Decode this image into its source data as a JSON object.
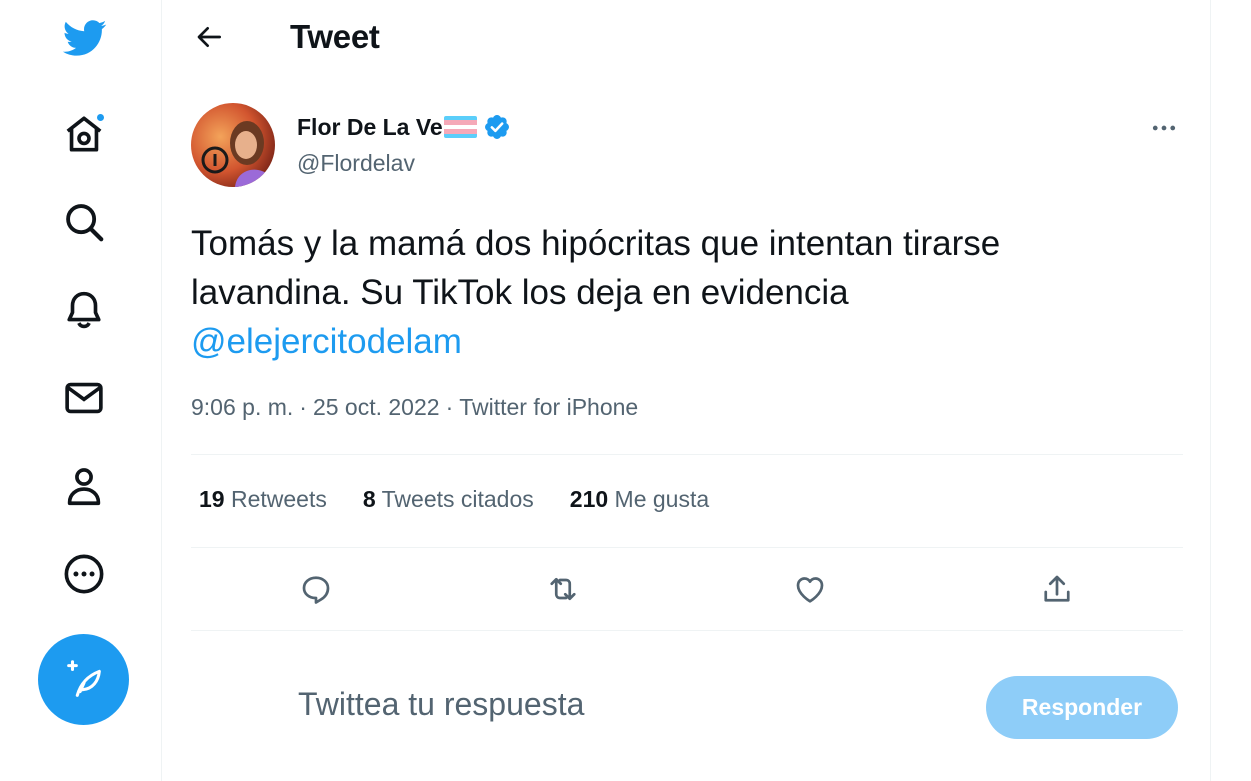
{
  "header": {
    "title": "Tweet"
  },
  "tweet": {
    "author_name": "Flor De La Ve",
    "author_handle": "@Flordelav",
    "text_line1": "Tomás y la mamá dos hipócritas que intentan tirarse",
    "text_line2": "lavandina. Su TikTok los deja en evidencia",
    "mention": "@elejercitodelam",
    "time": "9:06 p. m.",
    "sep1": "·",
    "date": "25 oct. 2022",
    "sep2": "·",
    "source": "Twitter for iPhone"
  },
  "stats": {
    "retweets_count": "19",
    "retweets_label": "Retweets",
    "quotes_count": "8",
    "quotes_label": "Tweets citados",
    "likes_count": "210",
    "likes_label": "Me gusta"
  },
  "reply": {
    "placeholder": "Twittea tu respuesta",
    "button_label": "Responder"
  },
  "icons": {
    "sidebar": [
      "twitter-logo-icon",
      "home-icon",
      "search-icon",
      "bell-icon",
      "mail-icon",
      "profile-icon",
      "more-circle-icon",
      "compose-icon"
    ],
    "header": [
      "back-arrow-icon"
    ],
    "tweet": [
      "verified-badge-icon",
      "trans-flag-icon",
      "more-dots-icon"
    ],
    "actions": [
      "reply-icon",
      "retweet-icon",
      "like-icon",
      "share-icon"
    ]
  },
  "colors": {
    "accent": "#1d9bf0",
    "accent_disabled": "#8ecdf8",
    "text_primary": "#0f1419",
    "text_secondary": "#536471",
    "divider": "#eff3f4"
  }
}
